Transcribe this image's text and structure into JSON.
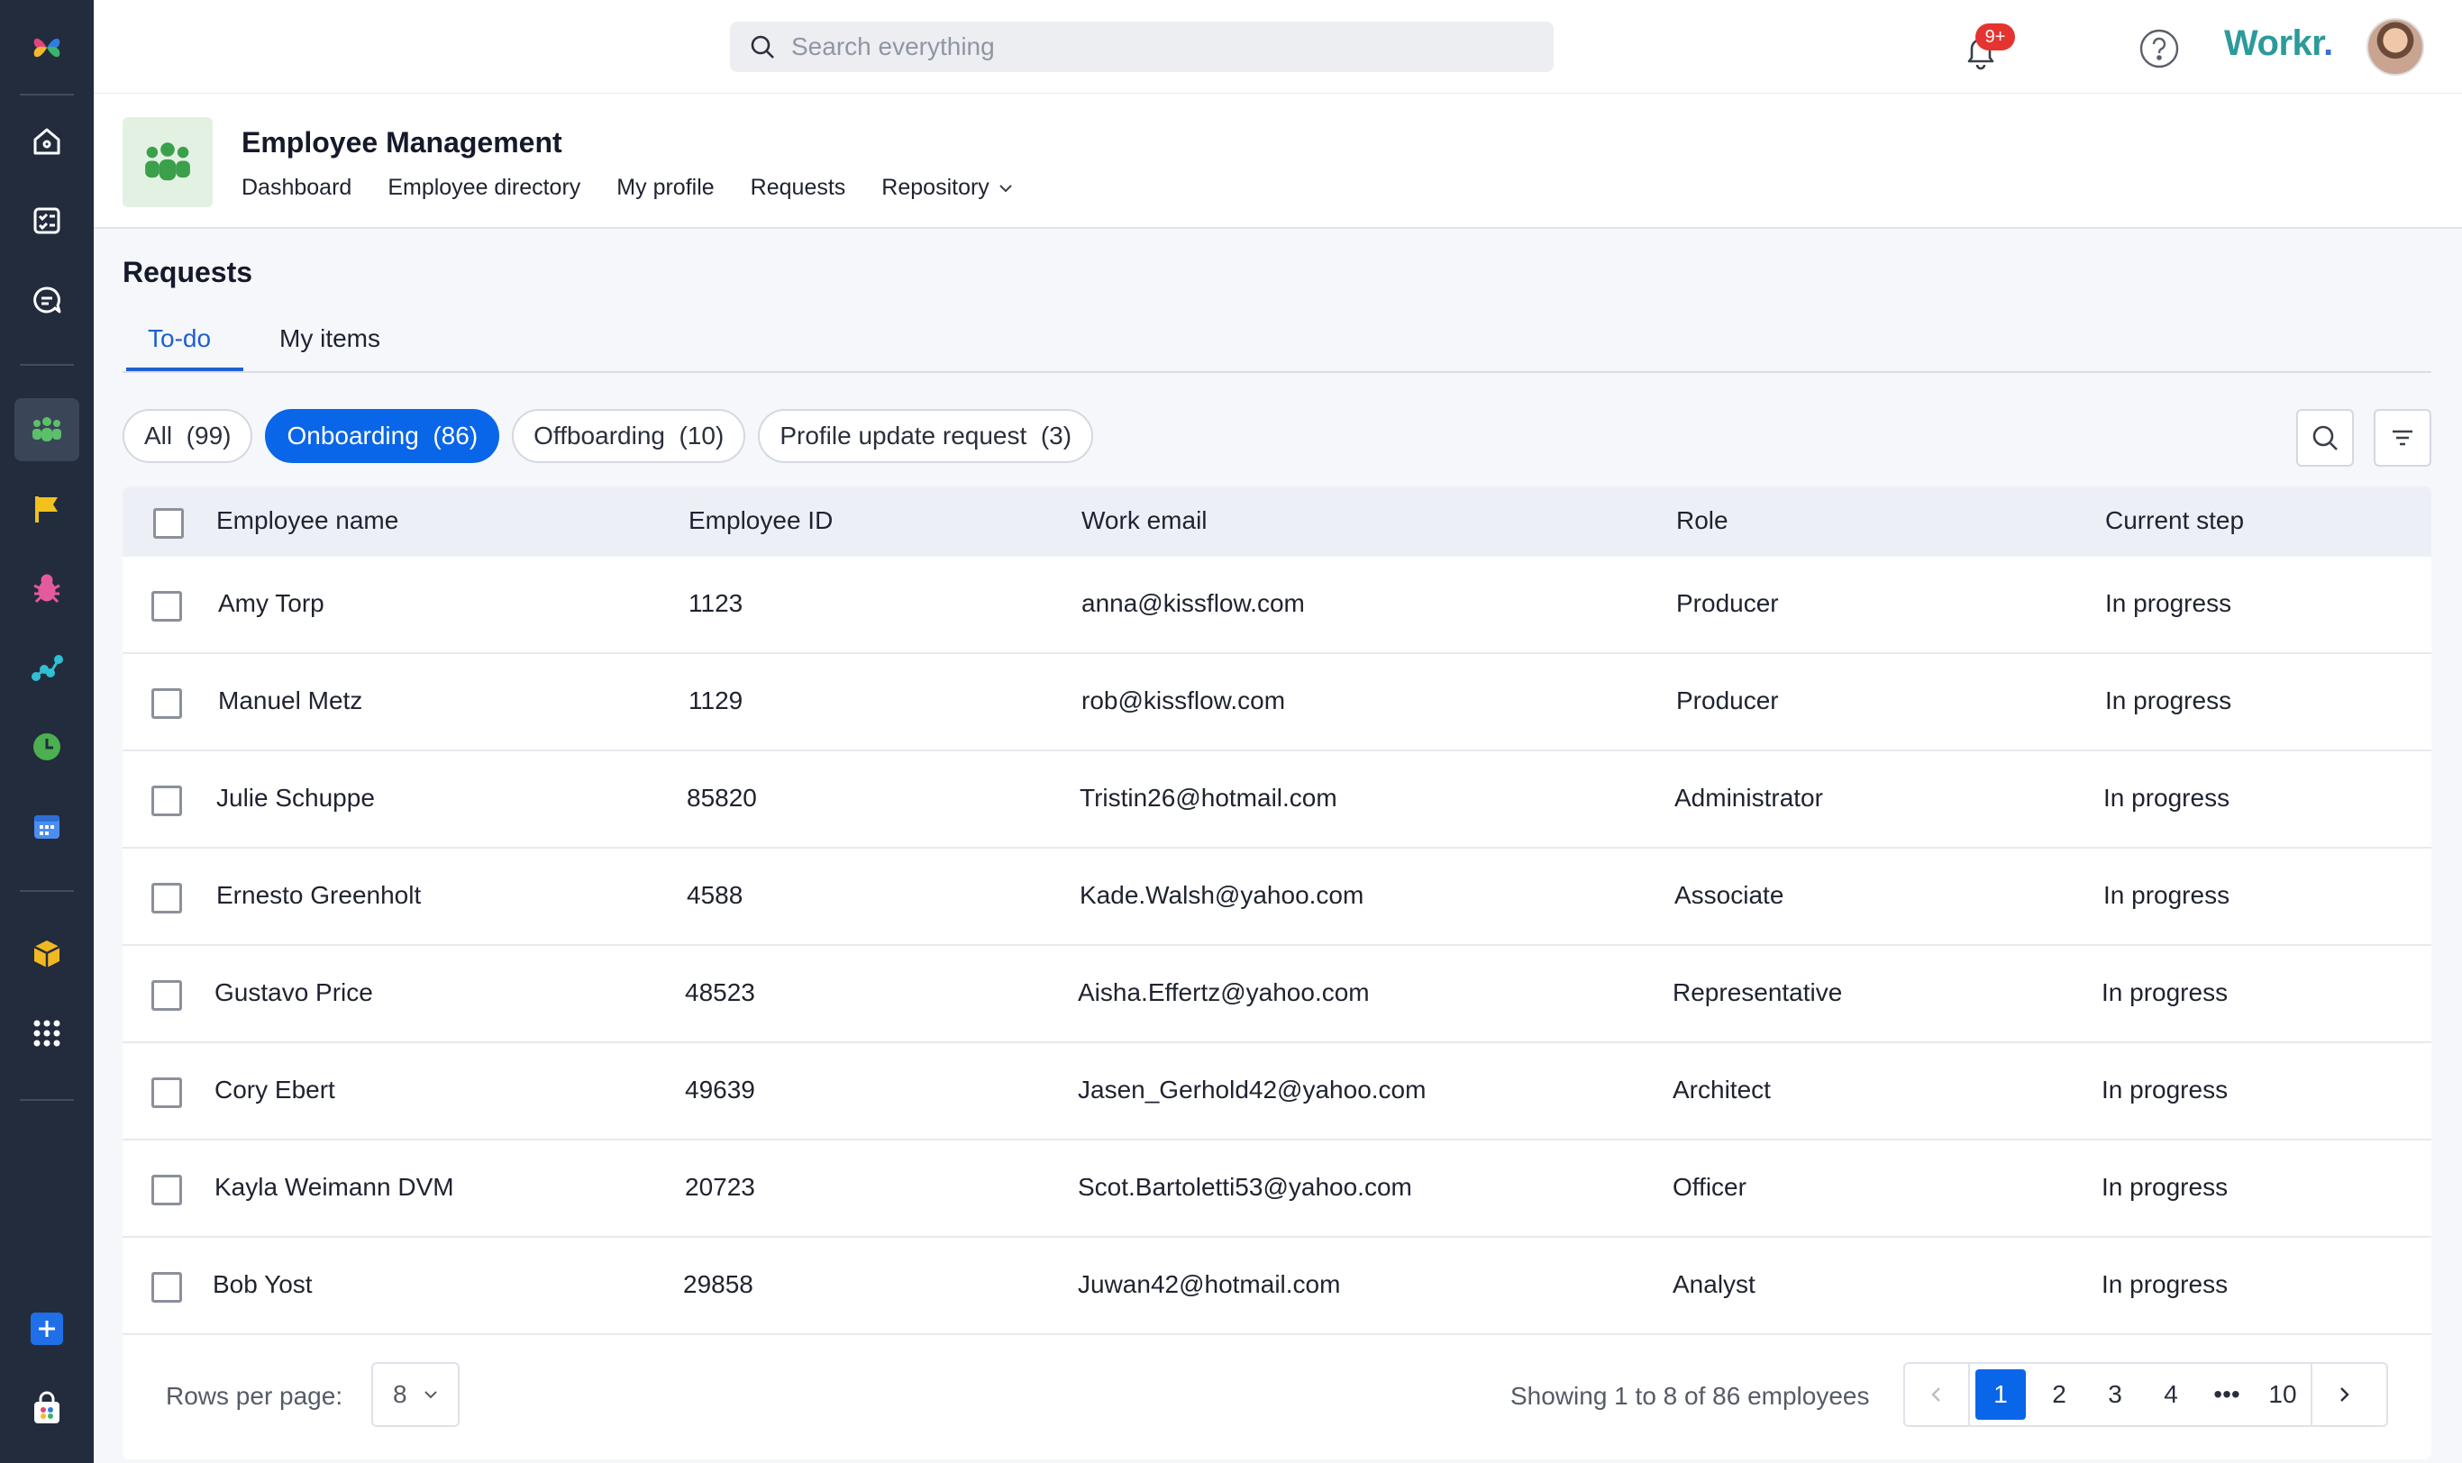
{
  "search": {
    "placeholder": "Search everything"
  },
  "notifications": {
    "badge": "9+"
  },
  "brand": {
    "name": "Workr",
    "dot": "."
  },
  "app": {
    "title": "Employee Management",
    "nav": [
      "Dashboard",
      "Employee directory",
      "My profile",
      "Requests",
      "Repository"
    ]
  },
  "requests": {
    "title": "Requests",
    "tabs": [
      "To-do",
      "My items"
    ],
    "chips": [
      {
        "label": "All  (99)"
      },
      {
        "label": "Onboarding  (86)"
      },
      {
        "label": "Offboarding  (10)"
      },
      {
        "label": "Profile update request  (3)"
      }
    ]
  },
  "table": {
    "headers": [
      "Employee name",
      "Employee ID",
      "Work email",
      "Role",
      "Current step"
    ],
    "rows": [
      [
        "Amy Torp",
        "1123",
        "anna@kissflow.com",
        "Producer",
        "In progress"
      ],
      [
        "Manuel Metz",
        "1129",
        "rob@kissflow.com",
        "Producer",
        "In progress"
      ],
      [
        "Julie Schuppe",
        "85820",
        "Tristin26@hotmail.com",
        "Administrator",
        "In progress"
      ],
      [
        "Ernesto Greenholt",
        "4588",
        "Kade.Walsh@yahoo.com",
        "Associate",
        "In progress"
      ],
      [
        "Gustavo Price",
        "48523",
        "Aisha.Effertz@yahoo.com",
        "Representative",
        "In progress"
      ],
      [
        "Cory Ebert",
        "49639",
        "Jasen_Gerhold42@yahoo.com",
        "Architect",
        "In progress"
      ],
      [
        "Kayla Weimann DVM",
        "20723",
        "Scot.Bartoletti53@yahoo.com",
        "Officer",
        "In progress"
      ],
      [
        "Bob Yost",
        "29858",
        "Juwan42@hotmail.com",
        "Analyst",
        "In progress"
      ]
    ]
  },
  "pagination": {
    "rows_per_page_label": "Rows per page:",
    "rows_per_page": "8",
    "showing": "Showing 1 to 8 of 86 employees",
    "pages": [
      "1",
      "2",
      "3",
      "4",
      "•••",
      "10"
    ],
    "current_page": "1"
  },
  "colors": {
    "accent": "#0a66e8",
    "rail": "#222c3d",
    "brand": "#2c9a9a"
  }
}
